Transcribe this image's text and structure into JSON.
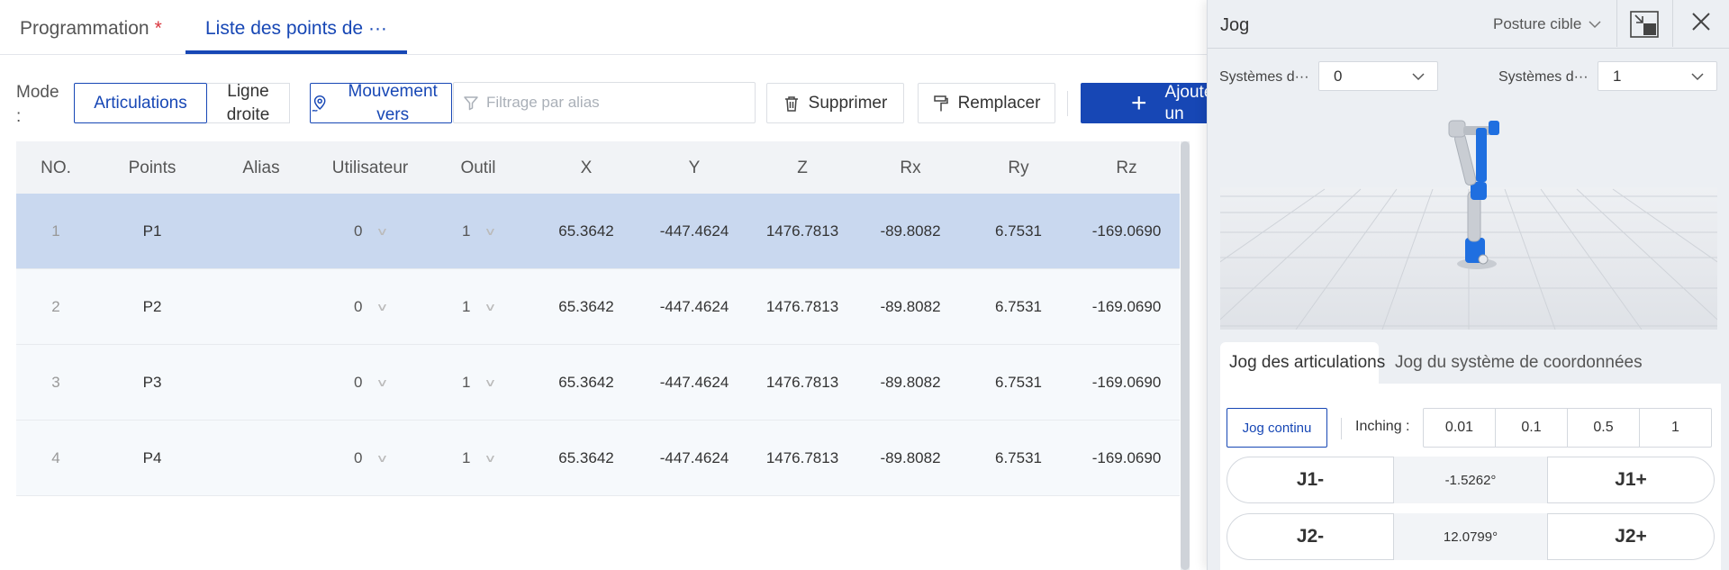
{
  "tabs": [
    {
      "label": "Programmation",
      "modified_mark": "*"
    },
    {
      "label": "Liste des points de ···"
    }
  ],
  "toolbar": {
    "mode_label": "Mode :",
    "mode_articulations": "Articulations",
    "mode_line": "Ligne droite",
    "move_button": "Mouvement vers",
    "filter_placeholder": "Filtrage par alias",
    "delete_button": "Supprimer",
    "replace_button": "Remplacer",
    "add_button": "Ajouter un"
  },
  "table": {
    "columns": [
      "NO.",
      "Points",
      "Alias",
      "Utilisateur",
      "Outil",
      "X",
      "Y",
      "Z",
      "Rx",
      "Ry",
      "Rz"
    ],
    "rows": [
      {
        "no": "1",
        "point": "P1",
        "alias": "",
        "user": "0",
        "tool": "1",
        "x": "65.3642",
        "y": "-447.4624",
        "z": "1476.7813",
        "rx": "-89.8082",
        "ry": "6.7531",
        "rz": "-169.0690",
        "selected": true
      },
      {
        "no": "2",
        "point": "P2",
        "alias": "",
        "user": "0",
        "tool": "1",
        "x": "65.3642",
        "y": "-447.4624",
        "z": "1476.7813",
        "rx": "-89.8082",
        "ry": "6.7531",
        "rz": "-169.0690",
        "selected": false
      },
      {
        "no": "3",
        "point": "P3",
        "alias": "",
        "user": "0",
        "tool": "1",
        "x": "65.3642",
        "y": "-447.4624",
        "z": "1476.7813",
        "rx": "-89.8082",
        "ry": "6.7531",
        "rz": "-169.0690",
        "selected": false
      },
      {
        "no": "4",
        "point": "P4",
        "alias": "",
        "user": "0",
        "tool": "1",
        "x": "65.3642",
        "y": "-447.4624",
        "z": "1476.7813",
        "rx": "-89.8082",
        "ry": "6.7531",
        "rz": "-169.0690",
        "selected": false
      }
    ]
  },
  "jog": {
    "title": "Jog",
    "posture": "Posture cible",
    "systems": [
      {
        "label": "Systèmes d···",
        "value": "0"
      },
      {
        "label": "Systèmes d···",
        "value": "1"
      }
    ],
    "tabs": [
      "Jog des articulations",
      "Jog du système de coordonnées"
    ],
    "continuous_button": "Jog continu",
    "inching_label": "Inching :",
    "steps": [
      "0.01",
      "0.1",
      "0.5",
      "1"
    ],
    "joints": [
      {
        "minus": "J1-",
        "value": "-1.5262°",
        "plus": "J1+"
      },
      {
        "minus": "J2-",
        "value": "12.0799°",
        "plus": "J2+"
      }
    ]
  },
  "colors": {
    "accent": "#1747b5",
    "selected_row": "#c9d8ef",
    "required_star": "#d9363e",
    "robot_blue": "#1f6fe0"
  }
}
